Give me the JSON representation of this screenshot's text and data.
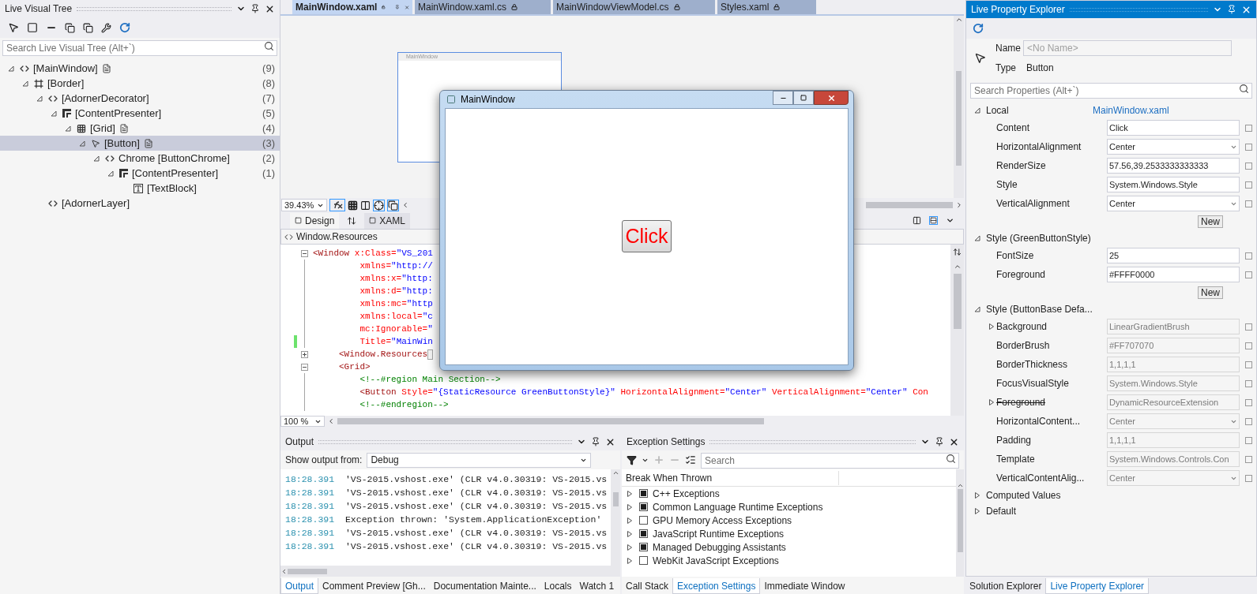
{
  "live_visual_tree": {
    "title": "Live Visual Tree",
    "search": {
      "placeholder": "Search Live Visual Tree (Alt+`)"
    },
    "tree": [
      {
        "kind": "code",
        "label": "[MainWindow]",
        "count": "(9)",
        "source": true,
        "expanded": true,
        "selected": false,
        "children": [
          {
            "kind": "border",
            "label": "[Border]",
            "count": "(8)",
            "source": false,
            "expanded": true,
            "selected": false,
            "children": [
              {
                "kind": "code",
                "label": "[AdornerDecorator]",
                "count": "(7)",
                "source": false,
                "expanded": true,
                "selected": false,
                "children": [
                  {
                    "kind": "presenter",
                    "label": "[ContentPresenter]",
                    "count": "(5)",
                    "source": false,
                    "expanded": true,
                    "selected": false,
                    "children": [
                      {
                        "kind": "grid",
                        "label": "[Grid]",
                        "count": "(4)",
                        "source": true,
                        "expanded": true,
                        "selected": false,
                        "children": [
                          {
                            "kind": "button",
                            "label": "[Button]",
                            "count": "(3)",
                            "source": true,
                            "expanded": true,
                            "selected": true,
                            "children": [
                              {
                                "kind": "code",
                                "label": "Chrome [ButtonChrome]",
                                "count": "(2)",
                                "source": false,
                                "expanded": true,
                                "selected": false,
                                "children": [
                                  {
                                    "kind": "presenter",
                                    "label": "[ContentPresenter]",
                                    "count": "(1)",
                                    "source": false,
                                    "expanded": true,
                                    "selected": false,
                                    "children": [
                                      {
                                        "kind": "text",
                                        "label": "[TextBlock]",
                                        "source": false,
                                        "selected": false
                                      }
                                    ]
                                  }
                                ]
                              }
                            ]
                          }
                        ]
                      }
                    ]
                  }
                ]
              },
              {
                "kind": "code",
                "label": "[AdornerLayer]",
                "source": false,
                "selected": false
              }
            ]
          }
        ]
      }
    ]
  },
  "editor": {
    "tabs": [
      {
        "label": "MainWindow.xaml",
        "selected": true
      },
      {
        "label": "MainWindow.xaml.cs",
        "selected": false
      },
      {
        "label": "MainWindowViewModel.cs",
        "selected": false
      },
      {
        "label": "Styles.xaml",
        "selected": false
      }
    ],
    "designer": {
      "preview_title": "MainWindow",
      "zoom": "39.43%"
    },
    "view_tabs": [
      {
        "label": "Design",
        "selected": true
      },
      {
        "label": "XAML",
        "selected": false
      }
    ],
    "breadcrumb": "Window.Resources",
    "code_lines": [
      {
        "collapsed": false,
        "changed": false,
        "segments": [
          {
            "kind": "tag",
            "text": "<Window"
          },
          {
            "kind": "attr",
            "text": " x:Class="
          },
          {
            "kind": "value",
            "text": "\"VS_201"
          }
        ]
      },
      {
        "changed": false,
        "segments": [
          {
            "kind": "attr",
            "text": "         xmlns="
          },
          {
            "kind": "value",
            "text": "\"http://"
          }
        ]
      },
      {
        "changed": false,
        "segments": [
          {
            "kind": "attr",
            "text": "         xmlns:x="
          },
          {
            "kind": "value",
            "text": "\"http:"
          }
        ]
      },
      {
        "changed": false,
        "segments": [
          {
            "kind": "attr",
            "text": "         xmlns:d="
          },
          {
            "kind": "value",
            "text": "\"http:"
          }
        ]
      },
      {
        "changed": false,
        "segments": [
          {
            "kind": "attr",
            "text": "         xmlns:mc="
          },
          {
            "kind": "value",
            "text": "\"http"
          }
        ]
      },
      {
        "changed": false,
        "segments": [
          {
            "kind": "attr",
            "text": "         xmlns:local="
          },
          {
            "kind": "value",
            "text": "\"c"
          }
        ]
      },
      {
        "changed": false,
        "segments": [
          {
            "kind": "attr",
            "text": "         mc:Ignorable="
          },
          {
            "kind": "value",
            "text": "\""
          }
        ]
      },
      {
        "changed": true,
        "segments": [
          {
            "kind": "attr",
            "text": "         Title="
          },
          {
            "kind": "value",
            "text": "\"MainWin"
          }
        ]
      },
      {
        "collapsed": true,
        "changed": false,
        "segments": [
          {
            "kind": "tag",
            "text": "     <Window.Resources"
          }
        ]
      },
      {
        "collapsed": false,
        "changed": false,
        "segments": [
          {
            "kind": "tag",
            "text": "     <Grid>"
          }
        ]
      },
      {
        "changed": false,
        "segments": [
          {
            "kind": "comment",
            "text": "         <!--#region Main Section-->"
          }
        ]
      },
      {
        "changed": false,
        "segments": [
          {
            "kind": "tag",
            "text": "         <Button"
          },
          {
            "kind": "attr",
            "text": " Style="
          },
          {
            "kind": "value",
            "text": "\"{StaticResource GreenButtonStyle}\""
          },
          {
            "kind": "attr",
            "text": " HorizontalAlignment="
          },
          {
            "kind": "value",
            "text": "\"Center\""
          },
          {
            "kind": "attr",
            "text": " VerticalAlignment="
          },
          {
            "kind": "value",
            "text": "\"Center\""
          },
          {
            "kind": "attr",
            "text": " Con"
          }
        ]
      },
      {
        "changed": false,
        "segments": [
          {
            "kind": "comment",
            "text": "         <!--#endregion-->"
          }
        ]
      }
    ],
    "code_zoom": "100 %"
  },
  "running_window": {
    "title": "MainWindow",
    "button": "Click"
  },
  "output": {
    "title": "Output",
    "source_label": "Show output from:",
    "source": "Debug",
    "lines": [
      {
        "time": "18:28.391",
        "message": "'VS-2015.vshost.exe' (CLR v4.0.30319: VS-2015.vs"
      },
      {
        "time": "18:28.391",
        "message": "'VS-2015.vshost.exe' (CLR v4.0.30319: VS-2015.vs"
      },
      {
        "time": "18:28.391",
        "message": "'VS-2015.vshost.exe' (CLR v4.0.30319: VS-2015.vs"
      },
      {
        "time": "18:28.391",
        "message": "Exception thrown: 'System.ApplicationException'"
      },
      {
        "time": "18:28.391",
        "message": "'VS-2015.vshost.exe' (CLR v4.0.30319: VS-2015.vs"
      },
      {
        "time": "18:28.391",
        "message": "'VS-2015.vshost.exe' (CLR v4.0.30319: VS-2015.vs"
      }
    ],
    "tabs": [
      {
        "label": "Output",
        "selected": true
      },
      {
        "label": "Comment Preview [Gh...",
        "selected": false
      },
      {
        "label": "Documentation Mainte...",
        "selected": false
      },
      {
        "label": "Locals",
        "selected": false
      },
      {
        "label": "Watch 1",
        "selected": false
      }
    ]
  },
  "exception_settings": {
    "title": "Exception Settings",
    "search": {
      "placeholder": "Search"
    },
    "column": "Break When Thrown",
    "rows": [
      {
        "label": "C++ Exceptions",
        "checked": true,
        "expanded": false
      },
      {
        "label": "Common Language Runtime Exceptions",
        "checked": true,
        "expanded": false
      },
      {
        "label": "GPU Memory Access Exceptions",
        "checked": false,
        "expanded": false
      },
      {
        "label": "JavaScript Runtime Exceptions",
        "checked": true,
        "expanded": false
      },
      {
        "label": "Managed Debugging Assistants",
        "checked": true,
        "expanded": false
      },
      {
        "label": "WebKit JavaScript Exceptions",
        "checked": false,
        "expanded": false
      }
    ],
    "tabs": [
      {
        "label": "Call Stack",
        "selected": false
      },
      {
        "label": "Exception Settings",
        "selected": true
      },
      {
        "label": "Immediate Window",
        "selected": false
      }
    ]
  },
  "property_explorer": {
    "title": "Live Property Explorer",
    "name_label": "Name",
    "name_placeholder": "<No Name>",
    "type_label": "Type",
    "type": "Button",
    "search": {
      "placeholder": "Search Properties (Alt+`)"
    },
    "sections": [
      {
        "title": "Local",
        "source": "MainWindow.xaml",
        "expanded": true,
        "new_button": "New",
        "properties": [
          {
            "name": "Content",
            "value": "Click",
            "kind": "text",
            "disabled": false,
            "overridden": false
          },
          {
            "name": "HorizontalAlignment",
            "value": "Center",
            "kind": "dropdown",
            "disabled": false,
            "overridden": false
          },
          {
            "name": "RenderSize",
            "value": "57.56,39.2533333333333",
            "kind": "text",
            "disabled": false,
            "overridden": false
          },
          {
            "name": "Style",
            "value": "System.Windows.Style",
            "kind": "text",
            "disabled": false,
            "overridden": false
          },
          {
            "name": "VerticalAlignment",
            "value": "Center",
            "kind": "dropdown",
            "disabled": false,
            "overridden": false
          }
        ]
      },
      {
        "title": "Style (GreenButtonStyle)",
        "expanded": true,
        "new_button": "New",
        "properties": [
          {
            "name": "FontSize",
            "value": "25",
            "kind": "text",
            "disabled": false,
            "overridden": false
          },
          {
            "name": "Foreground",
            "value": "#FFFF0000",
            "kind": "text",
            "disabled": false,
            "overridden": false
          }
        ]
      },
      {
        "title": "Style (ButtonBase Defa...",
        "expanded": true,
        "properties": [
          {
            "name": "Background",
            "value": "LinearGradientBrush",
            "kind": "text",
            "disabled": true,
            "overridden": false,
            "expanded": false
          },
          {
            "name": "BorderBrush",
            "value": "#FF707070",
            "kind": "text",
            "disabled": true,
            "overridden": false
          },
          {
            "name": "BorderThickness",
            "value": "1,1,1,1",
            "kind": "text",
            "disabled": true,
            "overridden": false
          },
          {
            "name": "FocusVisualStyle",
            "value": "System.Windows.Style",
            "kind": "text",
            "disabled": true,
            "overridden": false
          },
          {
            "name": "Foreground",
            "value": "DynamicResourceExtension",
            "kind": "text",
            "disabled": true,
            "overridden": true,
            "expanded": false
          },
          {
            "name": "HorizontalContent...",
            "value": "Center",
            "kind": "dropdown",
            "disabled": true,
            "overridden": false
          },
          {
            "name": "Padding",
            "value": "1,1,1,1",
            "kind": "text",
            "disabled": true,
            "overridden": false
          },
          {
            "name": "Template",
            "value": "System.Windows.Controls.Con",
            "kind": "text",
            "disabled": true,
            "overridden": false
          },
          {
            "name": "VerticalContentAlig...",
            "value": "Center",
            "kind": "dropdown",
            "disabled": true,
            "overridden": false
          }
        ]
      },
      {
        "title": "Computed Values",
        "expanded": false
      },
      {
        "title": "Default",
        "expanded": false
      }
    ],
    "tabs": [
      {
        "label": "Solution Explorer",
        "selected": false
      },
      {
        "label": "Live Property Explorer",
        "selected": true
      }
    ]
  }
}
